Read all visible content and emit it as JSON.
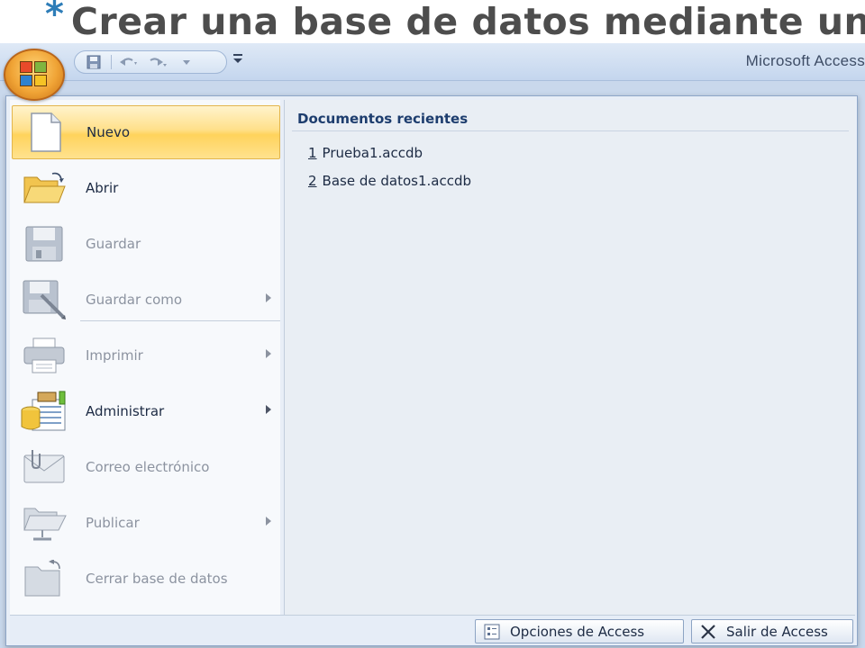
{
  "slide": {
    "bullet": "*",
    "title": "Crear una base de datos mediante una"
  },
  "window": {
    "app_title": "Microsoft Access",
    "quick_access": {
      "save_icon": "save-icon",
      "undo_icon": "undo-icon",
      "redo_icon": "redo-icon",
      "customize_icon": "customize-qat-icon"
    },
    "office_button_icon": "office-logo-icon"
  },
  "menu": {
    "items": [
      {
        "label": "Nuevo",
        "icon": "new-document-icon",
        "enabled": true,
        "selected": true,
        "submenu": false
      },
      {
        "label": "Abrir",
        "icon": "open-folder-icon",
        "enabled": true,
        "selected": false,
        "submenu": false
      },
      {
        "label": "Guardar",
        "icon": "save-icon",
        "enabled": false,
        "selected": false,
        "submenu": false
      },
      {
        "label": "Guardar como",
        "icon": "save-as-icon",
        "enabled": false,
        "selected": false,
        "submenu": true
      },
      {
        "label": "Imprimir",
        "icon": "printer-icon",
        "enabled": false,
        "selected": false,
        "submenu": true
      },
      {
        "label": "Administrar",
        "icon": "manage-database-icon",
        "enabled": true,
        "selected": false,
        "submenu": true
      },
      {
        "label": "Correo electrónico",
        "icon": "email-icon",
        "enabled": false,
        "selected": false,
        "submenu": false
      },
      {
        "label": "Publicar",
        "icon": "publish-icon",
        "enabled": false,
        "selected": false,
        "submenu": true
      },
      {
        "label": "Cerrar base de datos",
        "icon": "close-database-icon",
        "enabled": false,
        "selected": false,
        "submenu": false
      }
    ],
    "recent": {
      "header": "Documentos recientes",
      "files": [
        {
          "num": "1",
          "name": "Prueba1.accdb"
        },
        {
          "num": "2",
          "name": "Base de datos1.accdb"
        }
      ]
    },
    "footer": {
      "options_label": "Opciones de Access",
      "options_icon": "options-icon",
      "exit_label": "Salir de Access",
      "exit_icon": "close-x-icon"
    }
  },
  "colors": {
    "selected_highlight": "#ffd35c",
    "title_bullet": "#2e7db8",
    "title_text": "#4d4d4d",
    "ribbon_blue": "#c9d8ec"
  }
}
